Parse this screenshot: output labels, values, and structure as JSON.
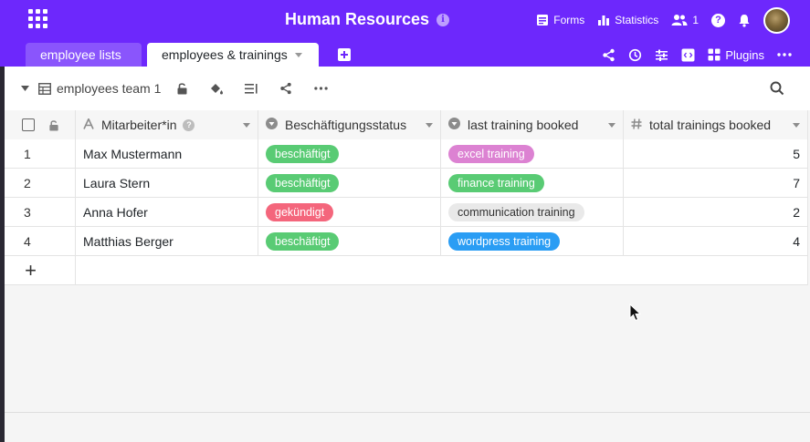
{
  "header": {
    "title": "Human Resources",
    "forms_label": "Forms",
    "statistics_label": "Statistics",
    "collaborators_count": "1",
    "help_label": "?"
  },
  "tabs": [
    {
      "label": "employee lists",
      "active": false
    },
    {
      "label": "employees & trainings",
      "active": true
    }
  ],
  "tools": {
    "plugins_label": "Plugins"
  },
  "toolbar": {
    "view_name": "employees team 1"
  },
  "columns": [
    {
      "name": "Mitarbeiter*in",
      "type": "text"
    },
    {
      "name": "Beschäftigungsstatus",
      "type": "single-select"
    },
    {
      "name": "last training booked",
      "type": "single-select"
    },
    {
      "name": "total trainings booked",
      "type": "number"
    }
  ],
  "rows": [
    {
      "num": "1",
      "name": "Max Mustermann",
      "status": "beschäftigt",
      "status_color": "#59cb74",
      "training": "excel training",
      "training_color": "#dc82d2",
      "training_text_color": "#ffffff",
      "total": "5"
    },
    {
      "num": "2",
      "name": "Laura Stern",
      "status": "beschäftigt",
      "status_color": "#59cb74",
      "training": "finance training",
      "training_color": "#59cb74",
      "training_text_color": "#ffffff",
      "total": "7"
    },
    {
      "num": "3",
      "name": "Anna Hofer",
      "status": "gekündigt",
      "status_color": "#f4667c",
      "training": "communication training",
      "training_color": "#e9e9e9",
      "training_text_color": "#333333",
      "total": "2"
    },
    {
      "num": "4",
      "name": "Matthias Berger",
      "status": "beschäftigt",
      "status_color": "#59cb74",
      "training": "wordpress training",
      "training_color": "#2a9df4",
      "training_text_color": "#ffffff",
      "total": "4"
    }
  ],
  "add_row_symbol": "+",
  "colors": {
    "brand": "#6d28fc",
    "tab_inactive": "#8a55fc"
  }
}
